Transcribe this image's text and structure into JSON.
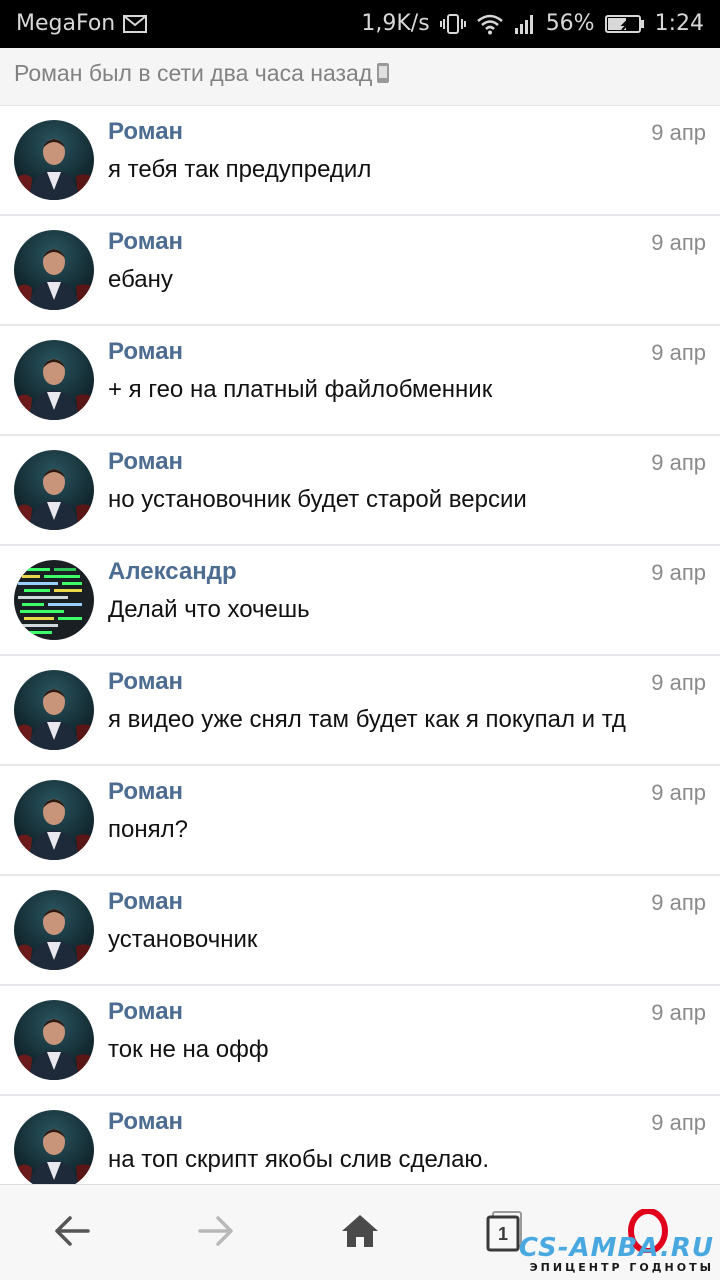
{
  "status_bar": {
    "carrier": "MegaFon",
    "speed": "1,9K/s",
    "battery": "56%",
    "time": "1:24"
  },
  "header": {
    "status_text": "Роман был в сети два часа назад"
  },
  "messages": [
    {
      "author": "Роман",
      "date": "9 апр",
      "text": "я тебя так предупредил",
      "avatar": "roman"
    },
    {
      "author": "Роман",
      "date": "9 апр",
      "text": "ебану",
      "avatar": "roman"
    },
    {
      "author": "Роман",
      "date": "9 апр",
      "text": "+ я гео на платный файлобменник",
      "avatar": "roman"
    },
    {
      "author": "Роман",
      "date": "9 апр",
      "text": "но установочник будет старой версии",
      "avatar": "roman"
    },
    {
      "author": "Александр",
      "date": "9 апр",
      "text": "Делай что хочешь",
      "avatar": "alexandr"
    },
    {
      "author": "Роман",
      "date": "9 апр",
      "text": "я видео уже снял там будет как я покупал и тд",
      "avatar": "roman"
    },
    {
      "author": "Роман",
      "date": "9 апр",
      "text": "понял?",
      "avatar": "roman"
    },
    {
      "author": "Роман",
      "date": "9 апр",
      "text": "установочник",
      "avatar": "roman"
    },
    {
      "author": "Роман",
      "date": "9 апр",
      "text": "ток не на офф",
      "avatar": "roman"
    },
    {
      "author": "Роман",
      "date": "9 апр",
      "text": "на топ скрипт якобы слив сделаю.",
      "avatar": "roman"
    }
  ],
  "bottom_nav": {
    "tabs_count": "1",
    "icons": [
      "back-arrow-icon",
      "forward-arrow-icon",
      "home-icon",
      "tabs-icon",
      "opera-icon"
    ]
  },
  "watermark": {
    "main": "CS-AMBA.RU",
    "sub": "ЭПИЦЕНТР ГОДНОТЫ"
  },
  "colors": {
    "author": "#4c6c91",
    "header_bg": "#f5f5f5",
    "opera_red": "#e0001b"
  }
}
